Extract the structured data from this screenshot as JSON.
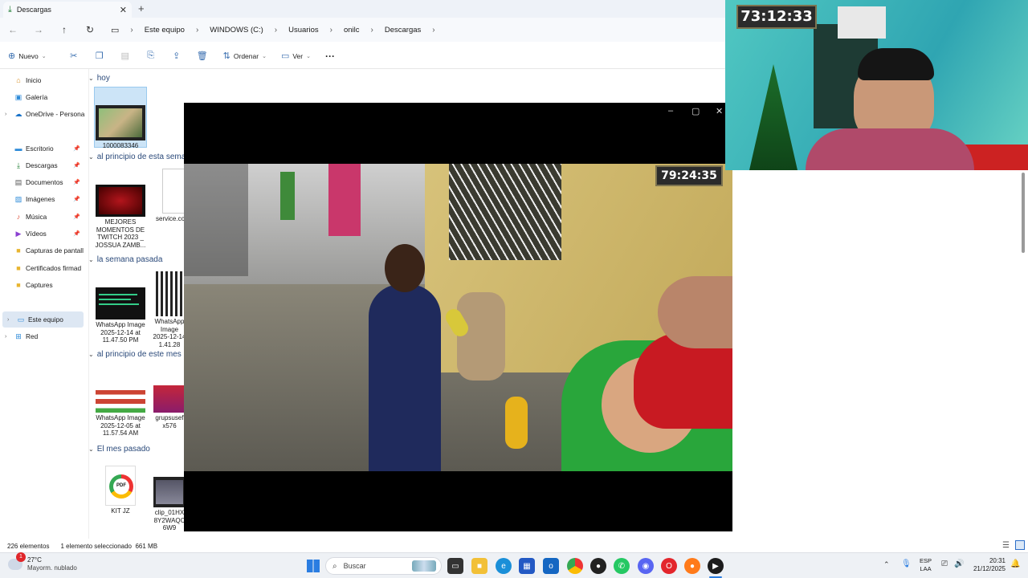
{
  "tab": {
    "title": "Descargas"
  },
  "breadcrumbs": [
    "Este equipo",
    "WINDOWS (C:)",
    "Usuarios",
    "onilc",
    "Descargas"
  ],
  "commands": {
    "new": "Nuevo",
    "sort": "Ordenar",
    "view": "Ver",
    "more": "···"
  },
  "sidebar": {
    "items": [
      {
        "label": "Inicio",
        "icon": "home-icon"
      },
      {
        "label": "Galería",
        "icon": "gallery-icon"
      },
      {
        "label": "OneDrive - Persona",
        "icon": "onedrive-icon"
      },
      {
        "label": "Escritorio",
        "icon": "desktop-icon"
      },
      {
        "label": "Descargas",
        "icon": "download-icon"
      },
      {
        "label": "Documentos",
        "icon": "documents-icon"
      },
      {
        "label": "Imágenes",
        "icon": "pictures-icon"
      },
      {
        "label": "Música",
        "icon": "music-icon"
      },
      {
        "label": "Vídeos",
        "icon": "videos-icon"
      },
      {
        "label": "Capturas de pantall",
        "icon": "folder-icon"
      },
      {
        "label": "Certificados firmad",
        "icon": "folder-icon"
      },
      {
        "label": "Captures",
        "icon": "folder-icon"
      },
      {
        "label": "Este equipo",
        "icon": "pc-icon"
      },
      {
        "label": "Red",
        "icon": "network-icon"
      }
    ]
  },
  "groups": {
    "today": "hoy",
    "start_week": "al principio de esta sema",
    "last_week": "la semana pasada",
    "start_month": "al principio de este mes",
    "last_month": "El mes pasado"
  },
  "files": {
    "f1": "1000083346",
    "f2": "MEJORES MOMENTOS DE TWITCH 2023 _ JOSSUA ZAMB...",
    "f3": "service.co",
    "f4": "WhatsApp Image 2025-12-14 at 11.47.50 PM",
    "f5": "WhatsApp Image 2025-12-14 1.41.28",
    "f6": "WhatsApp Image 2025-12-05 at 11.57.54 AM",
    "f7": "grupsusef x576",
    "f8": "KIT JZ",
    "f9": "clip_01HX 8Y2WAQC 6W9"
  },
  "player": {
    "timer": "79:24:35"
  },
  "webcam": {
    "timer": "73:12:33"
  },
  "status": {
    "count": "226 elementos",
    "selection": "1 elemento seleccionado",
    "size": "661 MB"
  },
  "taskbar": {
    "weather_temp": "27°C",
    "weather_desc": "Mayorm. nublado",
    "search": "Buscar",
    "lang1": "ESP",
    "lang2": "LAA",
    "time": "20:31",
    "date": "21/12/2025"
  }
}
